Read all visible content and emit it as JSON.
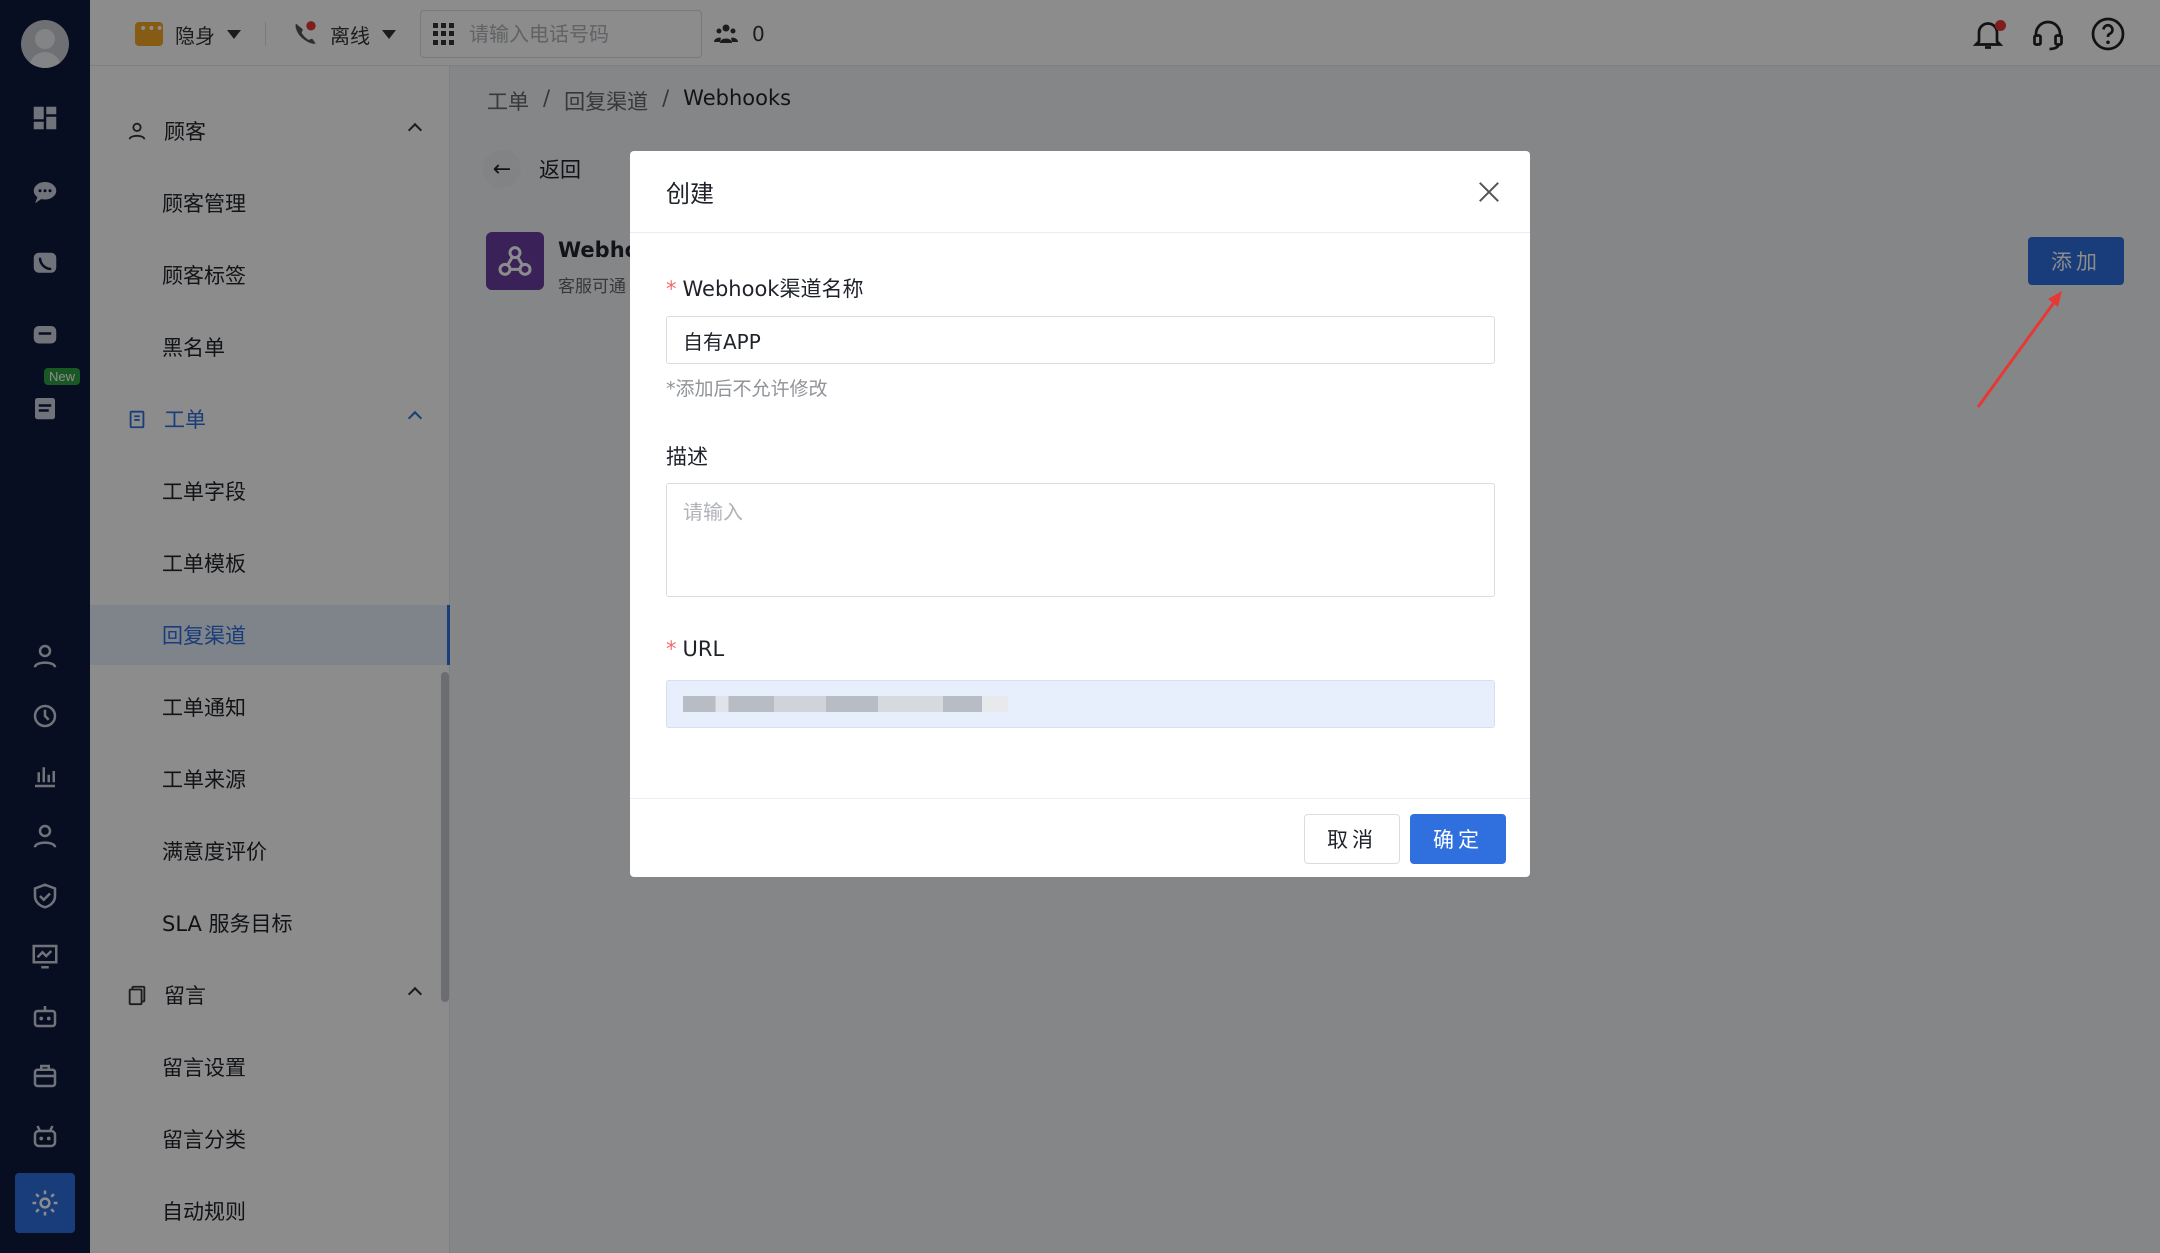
{
  "topbar": {
    "presence_label": "隐身",
    "line_label": "离线",
    "phone_placeholder": "请输入电话号码",
    "team_count": "0"
  },
  "rail": {
    "new_badge": "New"
  },
  "sidebar": {
    "groups": [
      {
        "label": "顾客"
      },
      {
        "label": "工单"
      },
      {
        "label": "留言"
      }
    ],
    "items": [
      {
        "label": "顾客管理"
      },
      {
        "label": "顾客标签"
      },
      {
        "label": "黑名单"
      },
      {
        "label": "工单字段"
      },
      {
        "label": "工单模板"
      },
      {
        "label": "回复渠道"
      },
      {
        "label": "工单通知"
      },
      {
        "label": "工单来源"
      },
      {
        "label": "满意度评价"
      },
      {
        "label": "SLA 服务目标"
      },
      {
        "label": "留言设置"
      },
      {
        "label": "留言分类"
      },
      {
        "label": "自动规则"
      }
    ]
  },
  "breadcrumb": {
    "items": [
      "工单",
      "/",
      "回复渠道",
      "/",
      "Webhooks"
    ]
  },
  "main": {
    "back_label": "返回",
    "card_title": "Webho",
    "card_desc": "客服可通",
    "add_label": "添加"
  },
  "dialog": {
    "title": "创建",
    "name_label": "Webhook渠道名称",
    "name_value": "自有APP",
    "name_hint": "*添加后不允许修改",
    "desc_label": "描述",
    "desc_placeholder": "请输入",
    "url_label": "URL",
    "cancel_label": "取消",
    "ok_label": "确定"
  },
  "colors": {
    "accent": "#2f6fde",
    "rail": "#0d1b3e",
    "required": "#f56c6c",
    "arrow": "#e53935"
  }
}
